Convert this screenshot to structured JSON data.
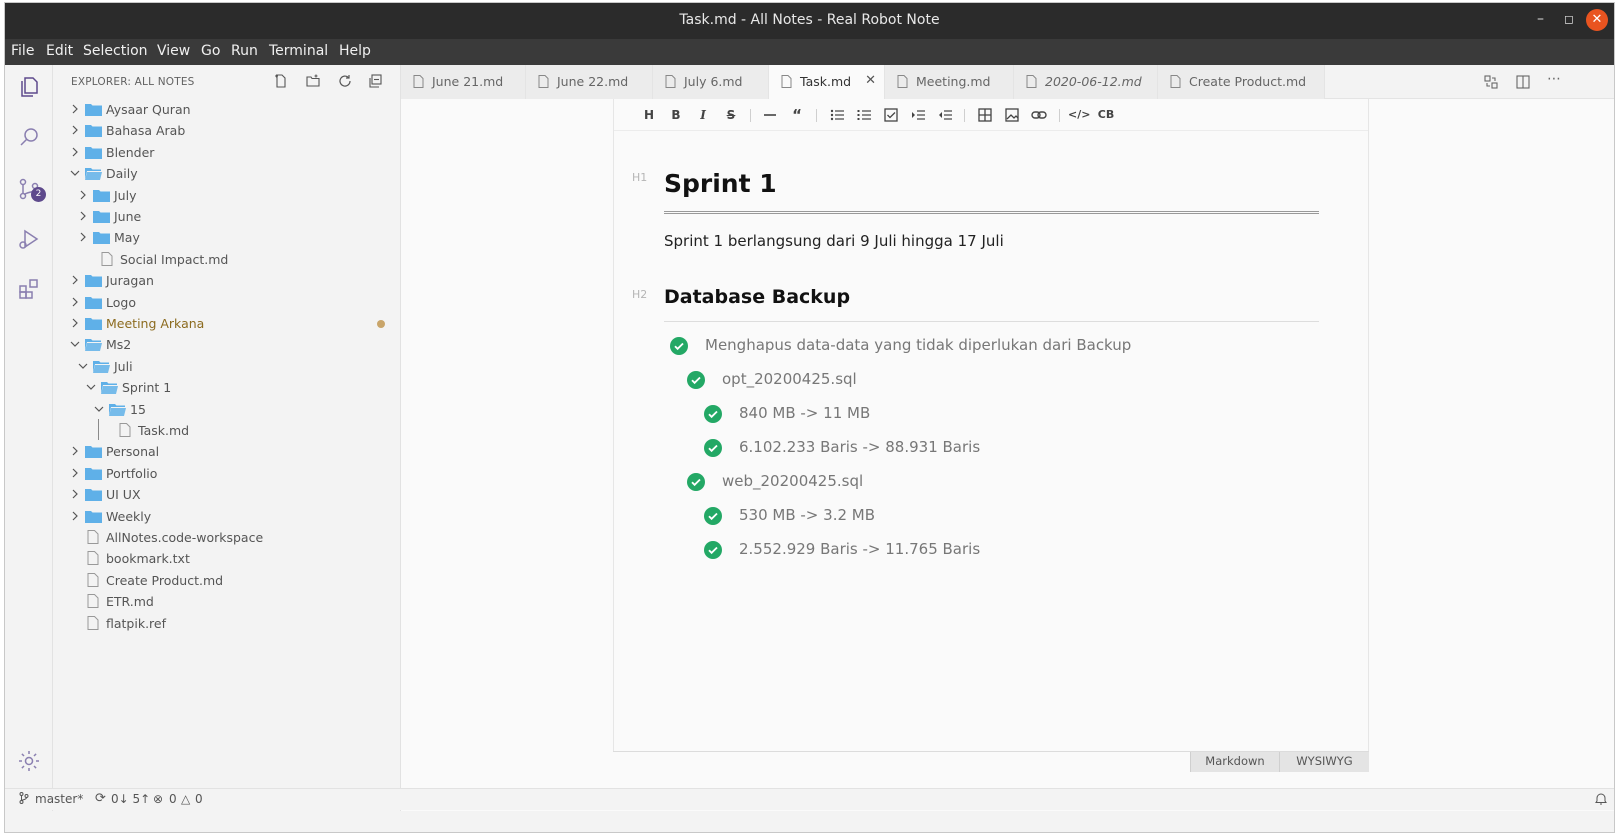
{
  "window": {
    "title": "Task.md - All Notes - Real Robot Note"
  },
  "menu": [
    "File",
    "Edit",
    "Selection",
    "View",
    "Go",
    "Run",
    "Terminal",
    "Help"
  ],
  "activity": {
    "scm_badge": "2"
  },
  "explorer": {
    "header": "EXPLORER: ALL NOTES",
    "items": [
      {
        "label": "Aysaar Quran"
      },
      {
        "label": "Bahasa Arab"
      },
      {
        "label": "Blender"
      },
      {
        "label": "Daily"
      },
      {
        "label": "July"
      },
      {
        "label": "June"
      },
      {
        "label": "May"
      },
      {
        "label": "Social Impact.md"
      },
      {
        "label": "Juragan"
      },
      {
        "label": "Logo"
      },
      {
        "label": "Meeting Arkana"
      },
      {
        "label": "Ms2"
      },
      {
        "label": "Juli"
      },
      {
        "label": "Sprint 1"
      },
      {
        "label": "15"
      },
      {
        "label": "Task.md"
      },
      {
        "label": "Personal"
      },
      {
        "label": "Portfolio"
      },
      {
        "label": "UI UX"
      },
      {
        "label": "Weekly"
      },
      {
        "label": "AllNotes.code-workspace"
      },
      {
        "label": "bookmark.txt"
      },
      {
        "label": "Create Product.md"
      },
      {
        "label": "ETR.md"
      },
      {
        "label": "flatpik.ref"
      }
    ]
  },
  "tabs": [
    {
      "label": "June 21.md"
    },
    {
      "label": "June 22.md"
    },
    {
      "label": "July 6.md"
    },
    {
      "label": "Task.md"
    },
    {
      "label": "Meeting.md"
    },
    {
      "label": "2020-06-12.md"
    },
    {
      "label": "Create Product.md"
    }
  ],
  "toolbar": {
    "heading": "H",
    "bold": "B",
    "italic": "I",
    "strike": "S",
    "codeblock": "CB"
  },
  "doc": {
    "h1_marker": "H1",
    "h1": "Sprint 1",
    "paragraph": "Sprint 1 berlangsung dari 9 Juli hingga 17 Juli",
    "h2_marker": "H2",
    "h2": "Database Backup",
    "tasks": [
      {
        "text": "Menghapus data-data yang tidak diperlukan dari Backup",
        "checked": true
      },
      {
        "text": "opt_20200425.sql",
        "checked": true
      },
      {
        "text": "840 MB -> 11 MB",
        "checked": true
      },
      {
        "text": "6.102.233 Baris -> 88.931 Baris",
        "checked": true
      },
      {
        "text": "web_20200425.sql",
        "checked": true
      },
      {
        "text": "530 MB -> 3.2 MB",
        "checked": true
      },
      {
        "text": "2.552.929 Baris -> 11.765 Baris",
        "checked": true
      }
    ]
  },
  "modes": {
    "markdown": "Markdown",
    "wysiwyg": "WYSIWYG"
  },
  "status": {
    "branch": "master*",
    "sync": "0↓ 5↑",
    "errors": "0",
    "warnings": "0"
  },
  "colors": {
    "folder": "#5fb0e8",
    "check": "#23a865",
    "badge": "#5e4a8c",
    "close": "#e95420"
  }
}
